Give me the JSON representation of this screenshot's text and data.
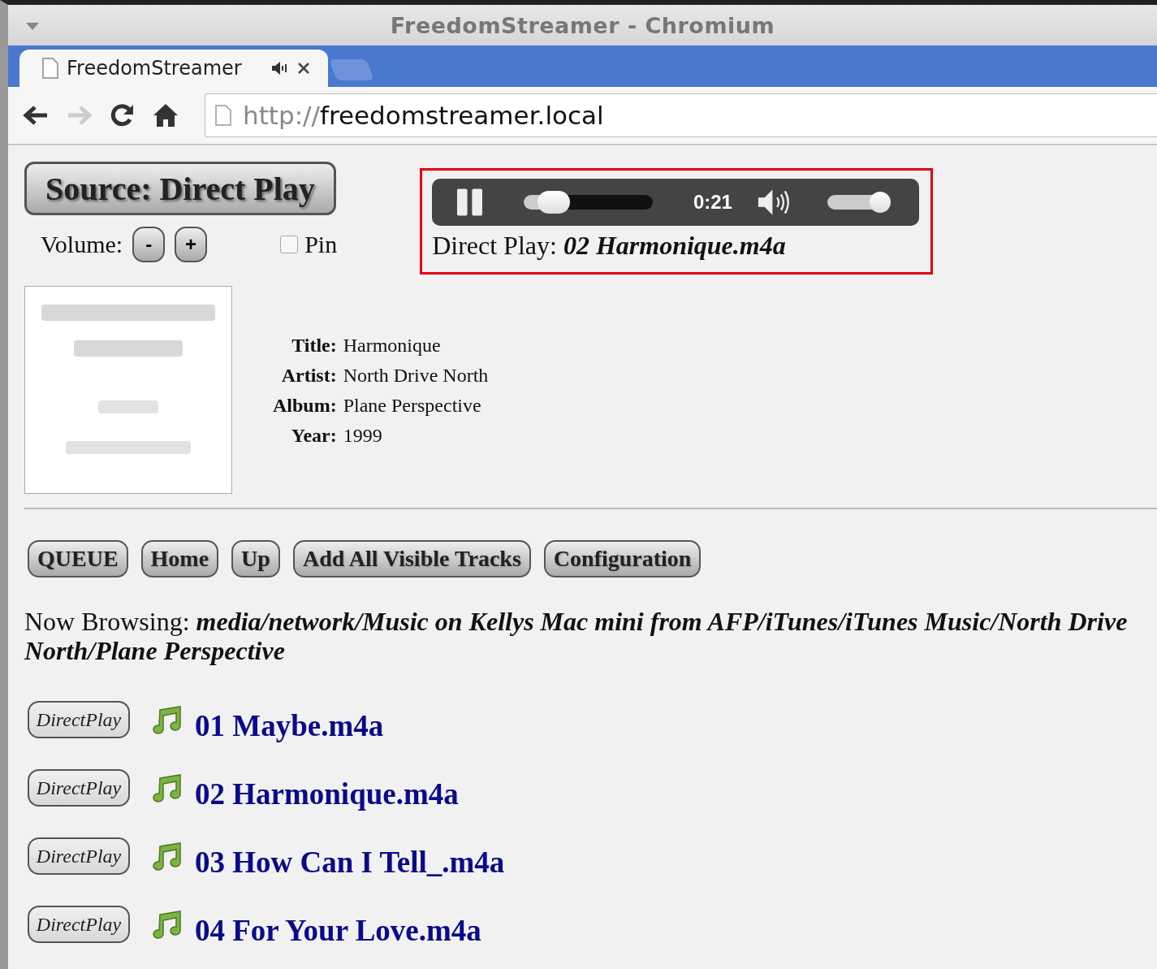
{
  "window": {
    "title": "FreedomStreamer - Chromium"
  },
  "tabs": [
    {
      "label": "FreedomStreamer",
      "selected": true,
      "audio": true
    }
  ],
  "address_bar": {
    "scheme": "http://",
    "host": "freedomstreamer.local"
  },
  "source_button": "Source: Direct Play",
  "volume": {
    "label": "Volume:",
    "buttons": [
      "-",
      "+"
    ]
  },
  "pin": {
    "label": "Pin",
    "checked": false
  },
  "player": {
    "playing": true,
    "level": 0.23,
    "time": "0:21",
    "volume": {
      "level": 0.9
    },
    "caption_label": "Direct Play:",
    "caption_track": "02 Harmonique.m4a"
  },
  "metadata": [
    {
      "label": "Title:",
      "value": "Harmonique"
    },
    {
      "label": "Artist:",
      "value": "North Drive North"
    },
    {
      "label": "Album:",
      "value": "Plane Perspective"
    },
    {
      "label": "Year:",
      "value": "1999"
    }
  ],
  "nav_buttons": [
    "QUEUE",
    "Home",
    "Up",
    "Add All Visible Tracks",
    "Configuration"
  ],
  "now_browsing": {
    "label": "Now Browsing:",
    "path": "media/network/Music on Kellys Mac mini from AFP/iTunes/iTunes Music/North Drive North/Plane Perspective"
  },
  "tracks": [
    {
      "button": "DirectPlay",
      "name": "01 Maybe.m4a"
    },
    {
      "button": "DirectPlay",
      "name": "02 Harmonique.m4a"
    },
    {
      "button": "DirectPlay",
      "name": "03 How Can I Tell_.m4a"
    },
    {
      "button": "DirectPlay",
      "name": "04 For Your Love.m4a"
    }
  ]
}
